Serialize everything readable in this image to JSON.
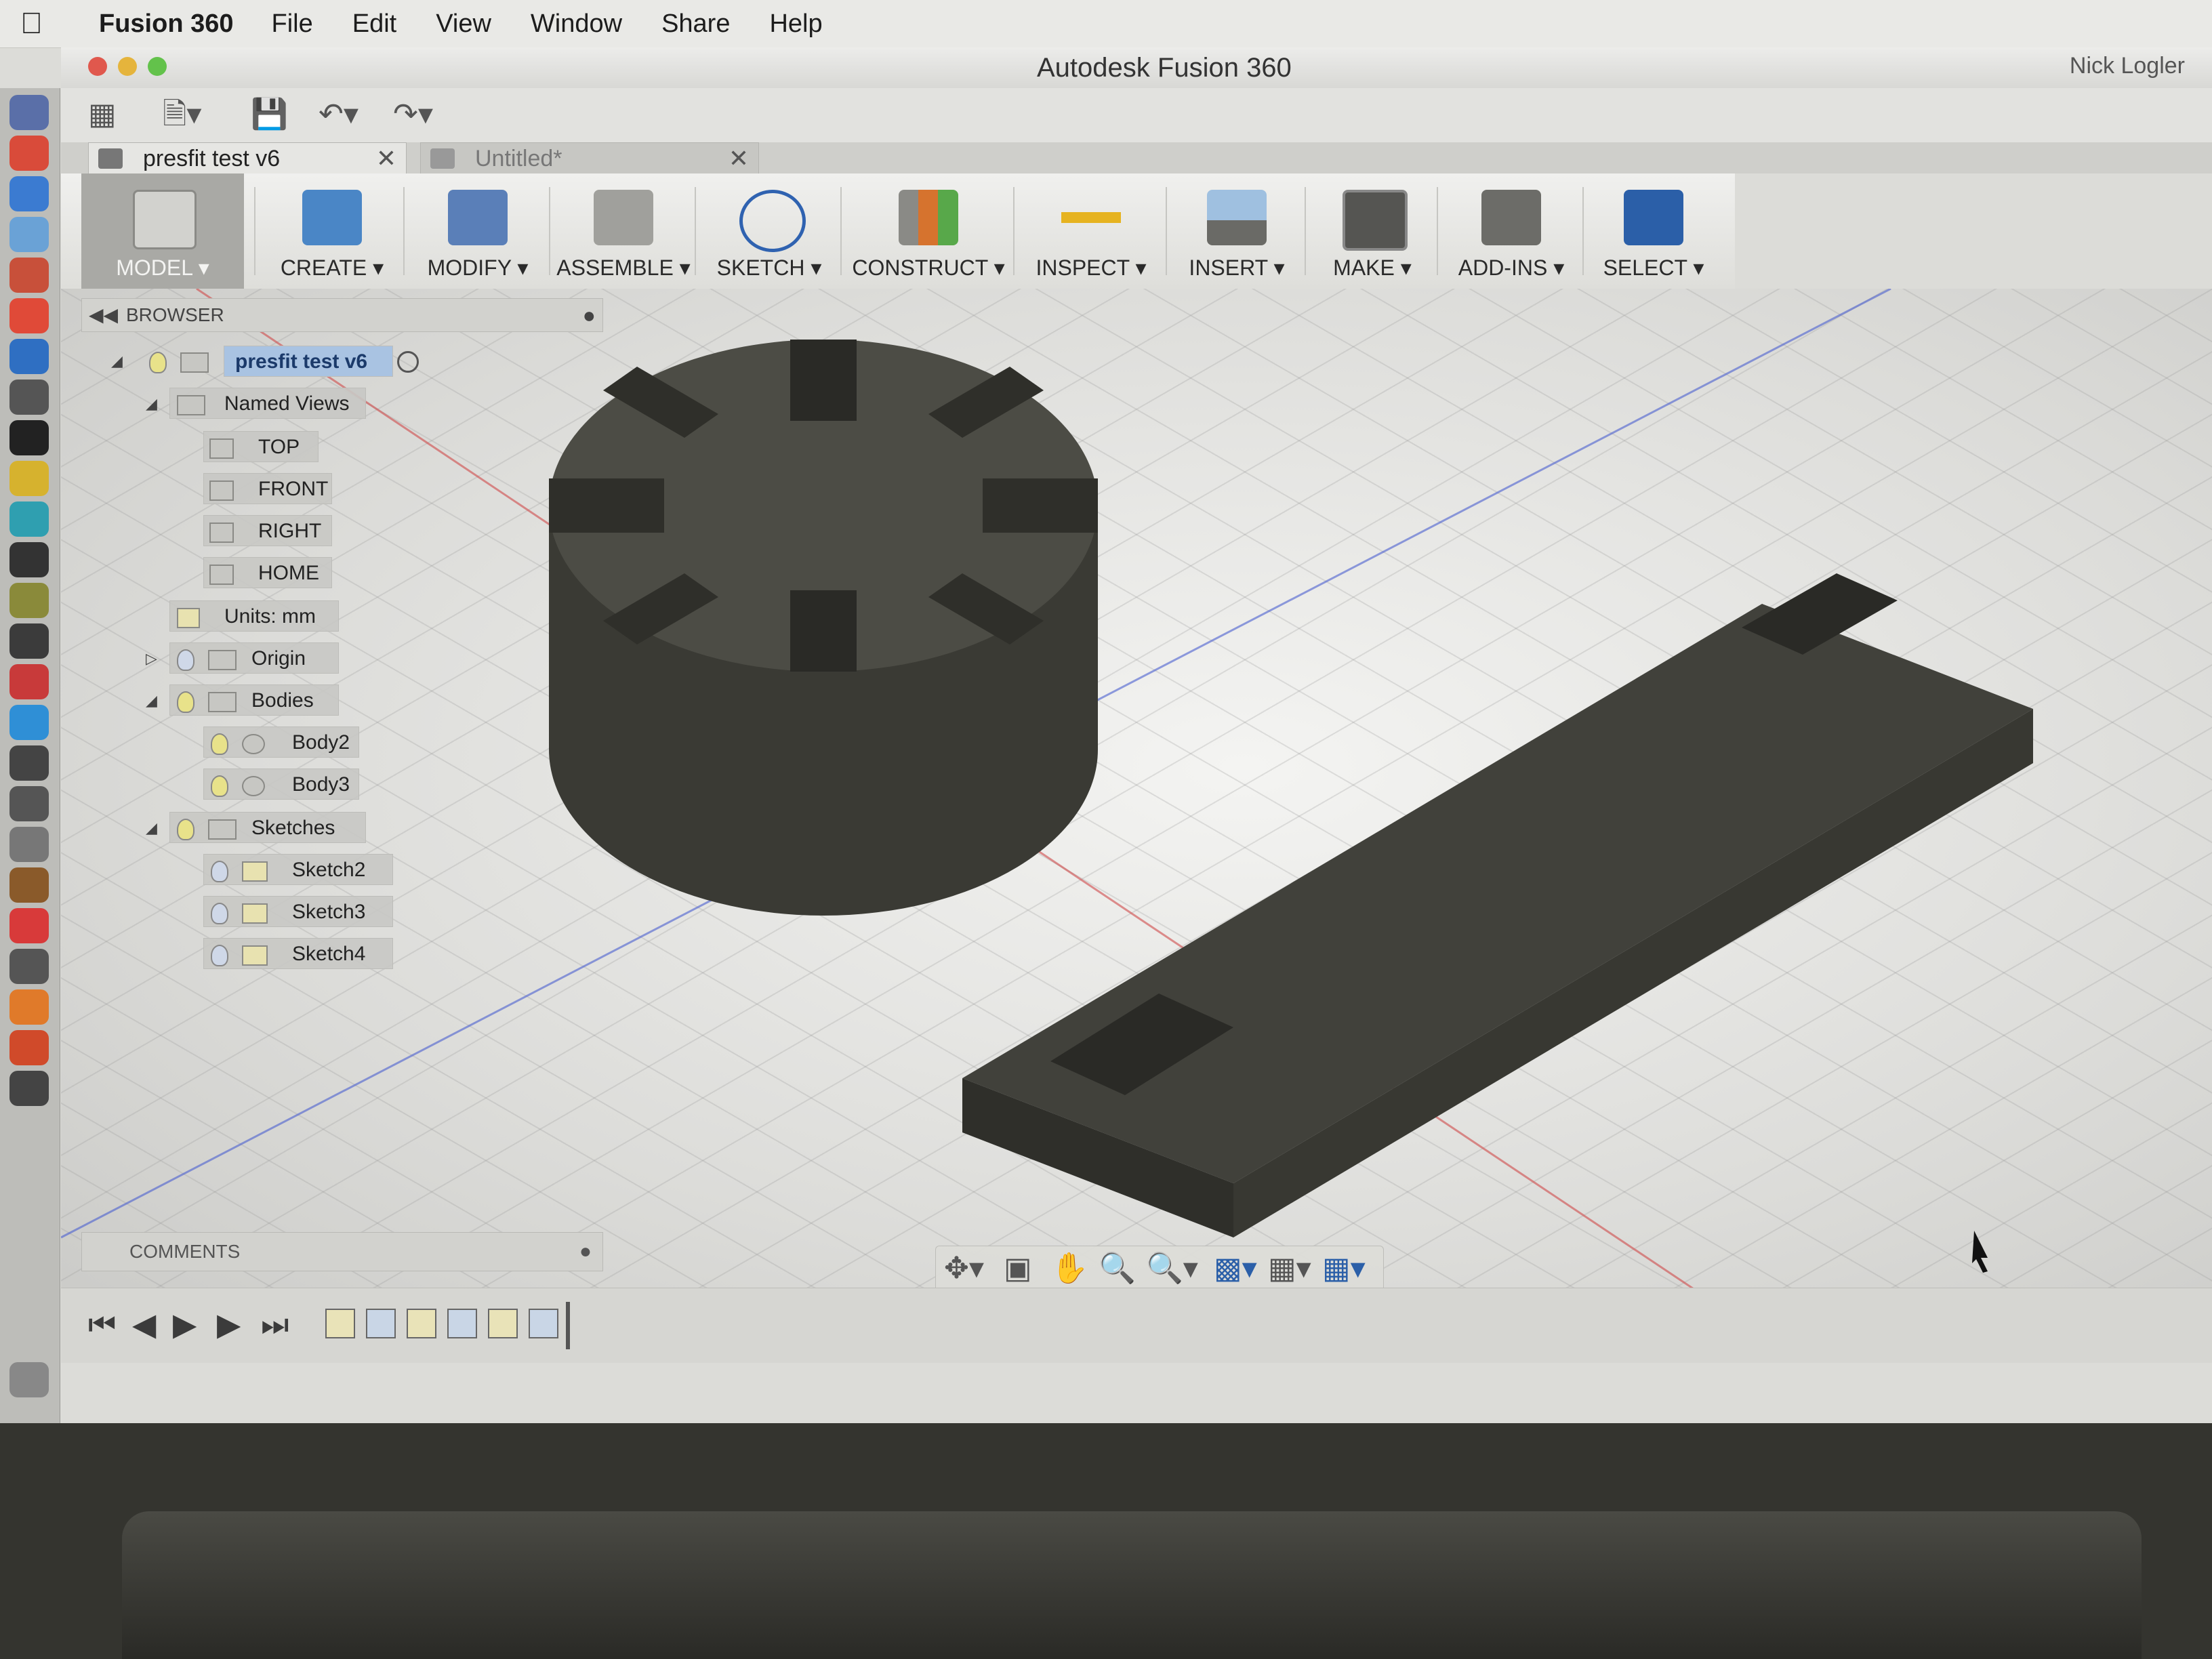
{
  "menubar": {
    "app_name": "Fusion 360",
    "items": [
      "File",
      "Edit",
      "View",
      "Window",
      "Share",
      "Help"
    ]
  },
  "window": {
    "title": "Autodesk Fusion 360",
    "user": "Nick Logler"
  },
  "tabs": [
    {
      "label": "presfit test v6",
      "active": true
    },
    {
      "label": "Untitled*",
      "active": false
    }
  ],
  "ribbon": {
    "items": [
      {
        "label": "MODEL ▾",
        "icon": "model-workspace-icon",
        "color": "#9a9a96"
      },
      {
        "label": "CREATE ▾",
        "icon": "box-icon",
        "color": "#4a86c6"
      },
      {
        "label": "MODIFY ▾",
        "icon": "push-pull-icon",
        "color": "#5a7fb8"
      },
      {
        "label": "ASSEMBLE ▾",
        "icon": "joint-icon",
        "color": "#8c8c88"
      },
      {
        "label": "SKETCH ▾",
        "icon": "sketch-arc-icon",
        "color": "#2f62b0"
      },
      {
        "label": "CONSTRUCT ▾",
        "icon": "plane-icon",
        "color": "#d6732e"
      },
      {
        "label": "INSPECT ▾",
        "icon": "measure-icon",
        "color": "#e6b320"
      },
      {
        "label": "INSERT ▾",
        "icon": "image-icon",
        "color": "#7a8fa8"
      },
      {
        "label": "MAKE ▾",
        "icon": "3d-print-icon",
        "color": "#555552"
      },
      {
        "label": "ADD-INS ▾",
        "icon": "scripts-icon",
        "color": "#6c6c68"
      },
      {
        "label": "SELECT ▾",
        "icon": "select-arrow-icon",
        "color": "#2b5fa8"
      }
    ]
  },
  "browser": {
    "title": "BROWSER",
    "root": "presfit test v6",
    "named_views": "Named Views",
    "views": [
      "TOP",
      "FRONT",
      "RIGHT",
      "HOME"
    ],
    "units": "Units: mm",
    "origin": "Origin",
    "bodies": "Bodies",
    "body_items": [
      "Body2",
      "Body3"
    ],
    "sketches": "Sketches",
    "sketch_items": [
      "Sketch2",
      "Sketch3",
      "Sketch4"
    ]
  },
  "comments": {
    "title": "COMMENTS"
  },
  "colors": {
    "body": "#46463f",
    "selection": "#a9c3e2",
    "axis_red": "#d04a4a",
    "axis_blue": "#4a5fd0"
  }
}
